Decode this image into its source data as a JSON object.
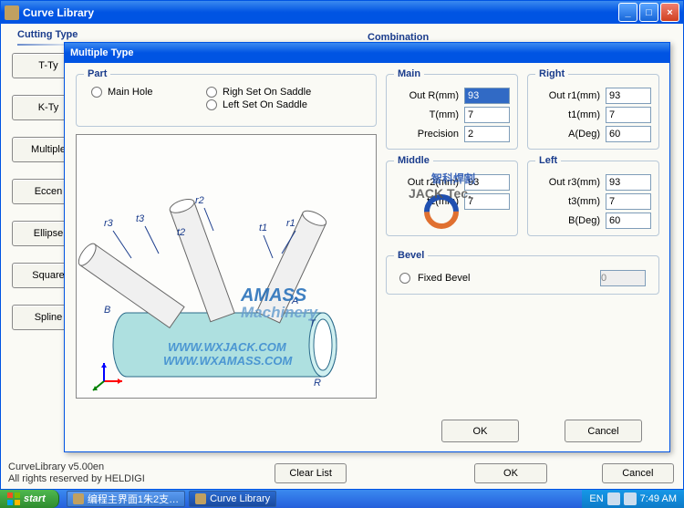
{
  "window": {
    "title": "Curve Library"
  },
  "sections": {
    "cutting": "Cutting Type",
    "combination": "Combination"
  },
  "cutting_buttons": [
    "T-Ty",
    "K-Ty",
    "Multiple",
    "Eccen",
    "Ellipse",
    "Square",
    "Spline"
  ],
  "footer": {
    "l1": "CurveLibrary v5.00en",
    "l2": "All rights reserved by HELDIGI"
  },
  "main_buttons": {
    "clear": "Clear List",
    "ok": "OK",
    "cancel": "Cancel"
  },
  "modal": {
    "title": "Multiple Type",
    "part": {
      "legend": "Part",
      "main_hole": "Main Hole",
      "right_saddle": "Righ Set On Saddle",
      "left_saddle": "Left Set On Saddle"
    },
    "main": {
      "legend": "Main",
      "out_r": {
        "label": "Out R(mm)",
        "value": "93"
      },
      "t": {
        "label": "T(mm)",
        "value": "7"
      },
      "precision": {
        "label": "Precision",
        "value": "2"
      }
    },
    "right": {
      "legend": "Right",
      "out_r1": {
        "label": "Out r1(mm)",
        "value": "93"
      },
      "t1": {
        "label": "t1(mm)",
        "value": "7"
      },
      "a": {
        "label": "A(Deg)",
        "value": "60"
      }
    },
    "middle": {
      "legend": "Middle",
      "out_r2": {
        "label": "Out r2(mm)",
        "value": "93"
      },
      "t2": {
        "label": "t2(mm)",
        "value": "7"
      }
    },
    "left": {
      "legend": "Left",
      "out_r3": {
        "label": "Out r3(mm)",
        "value": "93"
      },
      "t3": {
        "label": "t3(mm)",
        "value": "7"
      },
      "b": {
        "label": "B(Deg)",
        "value": "60"
      }
    },
    "bevel": {
      "legend": "Bevel",
      "fixed": "Fixed Bevel",
      "value": "0"
    },
    "ok": "OK",
    "cancel": "Cancel",
    "watermark": {
      "brand1": "AMASS",
      "brand2": "Machinery",
      "brand3": "智科焊割",
      "brand4": "JACK Tec.",
      "url1": "WWW.WXJACK.COM",
      "url2": "WWW.WXAMASS.COM"
    },
    "diagram_labels": [
      "r3",
      "t3",
      "r2",
      "t2",
      "t1",
      "r1",
      "B",
      "A",
      "T",
      "R"
    ]
  },
  "taskbar": {
    "start": "start",
    "items": [
      "编程主界面1朱2支…",
      "Curve Library"
    ],
    "lang": "EN",
    "time": "7:49 AM"
  }
}
